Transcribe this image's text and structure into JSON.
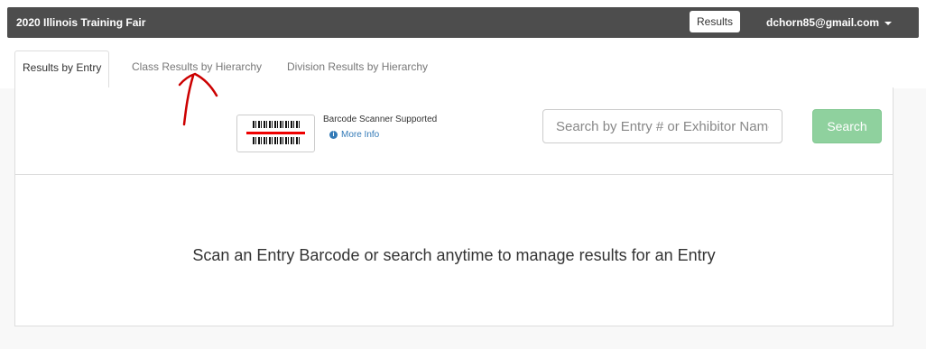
{
  "navbar": {
    "brand": "2020 Illinois Training Fair",
    "results_label": "Results",
    "user_email": "dchorn85@gmail.com"
  },
  "tabs": [
    {
      "label": "Results by Entry",
      "active": true
    },
    {
      "label": "Class Results by Hierarchy",
      "active": false
    },
    {
      "label": "Division Results by Hierarchy",
      "active": false
    }
  ],
  "scanner": {
    "label": "Barcode Scanner Supported",
    "info_label": "More Info",
    "icon": "barcode-icon"
  },
  "search": {
    "placeholder": "Search by Entry # or Exhibitor Name",
    "button_label": "Search"
  },
  "message": "Scan an Entry Barcode or search anytime to manage results for an Entry",
  "colors": {
    "navbar_bg": "#4d4d4d",
    "search_button": "#8fd19e",
    "barcode_line": "#e00000",
    "link": "#337ab7",
    "annotation": "#cc0000"
  }
}
